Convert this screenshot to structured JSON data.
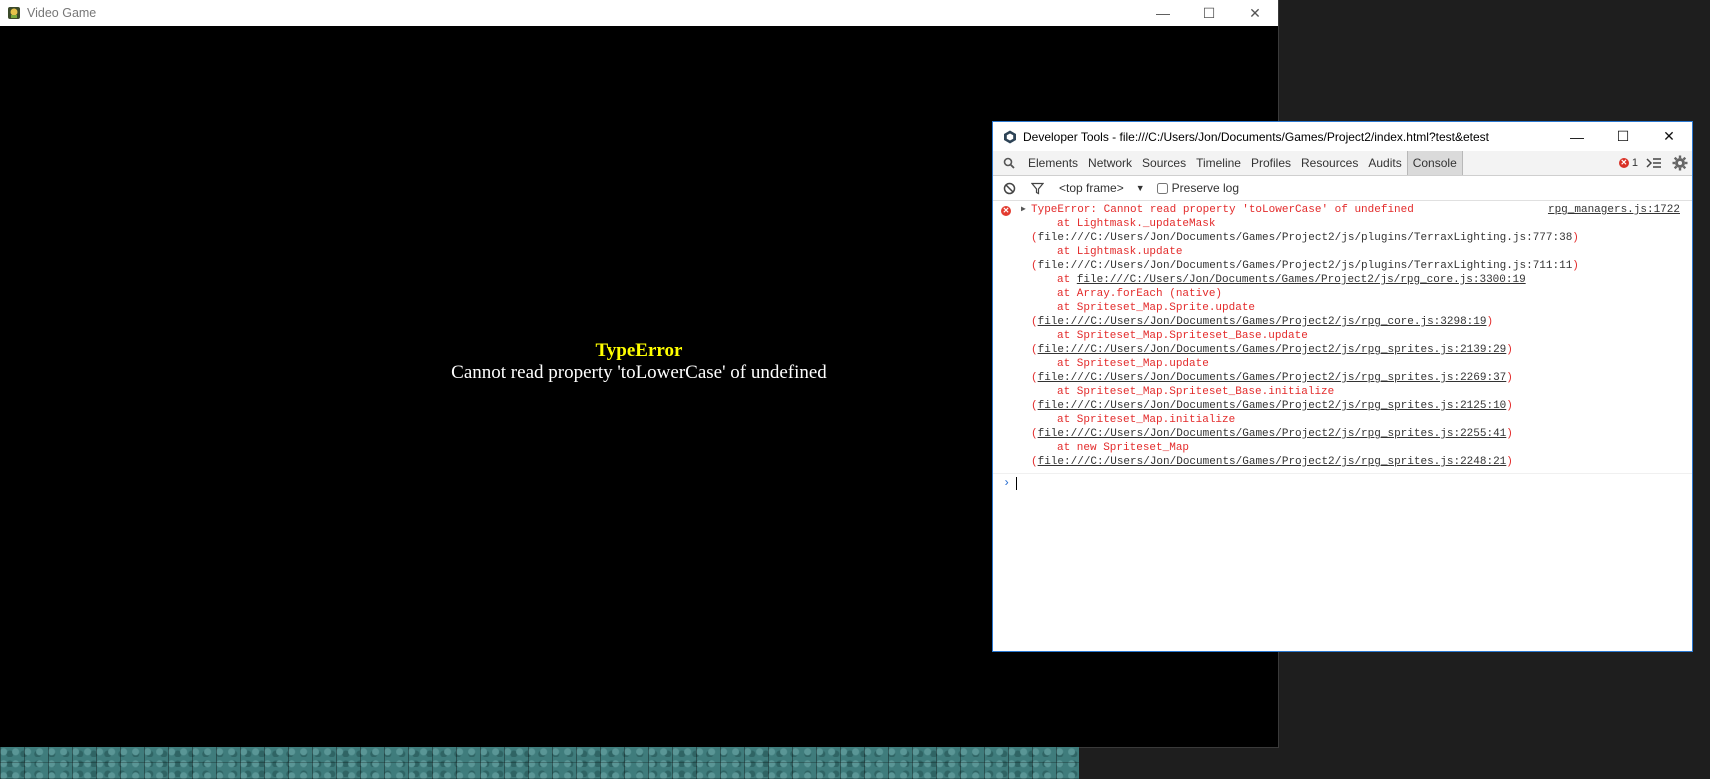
{
  "game_window": {
    "title": "Video Game",
    "controls": {
      "minimize": "—",
      "maximize": "☐",
      "close": "✕"
    },
    "error_title": "TypeError",
    "error_message": "Cannot read property 'toLowerCase' of undefined"
  },
  "devtools": {
    "title": "Developer Tools - file:///C:/Users/Jon/Documents/Games/Project2/index.html?test&etest",
    "controls": {
      "minimize": "—",
      "maximize": "☐",
      "close": "✕"
    },
    "tabs": [
      "Elements",
      "Network",
      "Sources",
      "Timeline",
      "Profiles",
      "Resources",
      "Audits",
      "Console"
    ],
    "active_tab": "Console",
    "error_count": "1",
    "toolbar": {
      "frame": "<top frame>",
      "preserve_log": "Preserve log"
    },
    "message": {
      "head": "TypeError: Cannot read property 'toLowerCase' of undefined",
      "source": "rpg_managers.js:1722",
      "stack": [
        {
          "at": "at Lightmask._updateMask",
          "path": "file:///C:/Users/Jon/Documents/Games/Project2/js/plugins/TerraxLighting.js:777:38",
          "link": false
        },
        {
          "at": "at Lightmask.update",
          "path": "file:///C:/Users/Jon/Documents/Games/Project2/js/plugins/TerraxLighting.js:711:11",
          "link": false
        },
        {
          "at": "at ",
          "inline": "file:///C:/Users/Jon/Documents/Games/Project2/js/rpg_core.js:3300:19"
        },
        {
          "at": "at Array.forEach (native)"
        },
        {
          "at": "at Spriteset_Map.Sprite.update",
          "path": "file:///C:/Users/Jon/Documents/Games/Project2/js/rpg_core.js:3298:19",
          "link": true
        },
        {
          "at": "at Spriteset_Map.Spriteset_Base.update",
          "path": "file:///C:/Users/Jon/Documents/Games/Project2/js/rpg_sprites.js:2139:29",
          "link": true
        },
        {
          "at": "at Spriteset_Map.update",
          "path": "file:///C:/Users/Jon/Documents/Games/Project2/js/rpg_sprites.js:2269:37",
          "link": true
        },
        {
          "at": "at Spriteset_Map.Spriteset_Base.initialize",
          "path": "file:///C:/Users/Jon/Documents/Games/Project2/js/rpg_sprites.js:2125:10",
          "link": true
        },
        {
          "at": "at Spriteset_Map.initialize",
          "path": "file:///C:/Users/Jon/Documents/Games/Project2/js/rpg_sprites.js:2255:41",
          "link": true
        },
        {
          "at": "at new Spriteset_Map",
          "path": "file:///C:/Users/Jon/Documents/Games/Project2/js/rpg_sprites.js:2248:21",
          "link": true
        }
      ]
    },
    "prompt_symbol": "›"
  }
}
